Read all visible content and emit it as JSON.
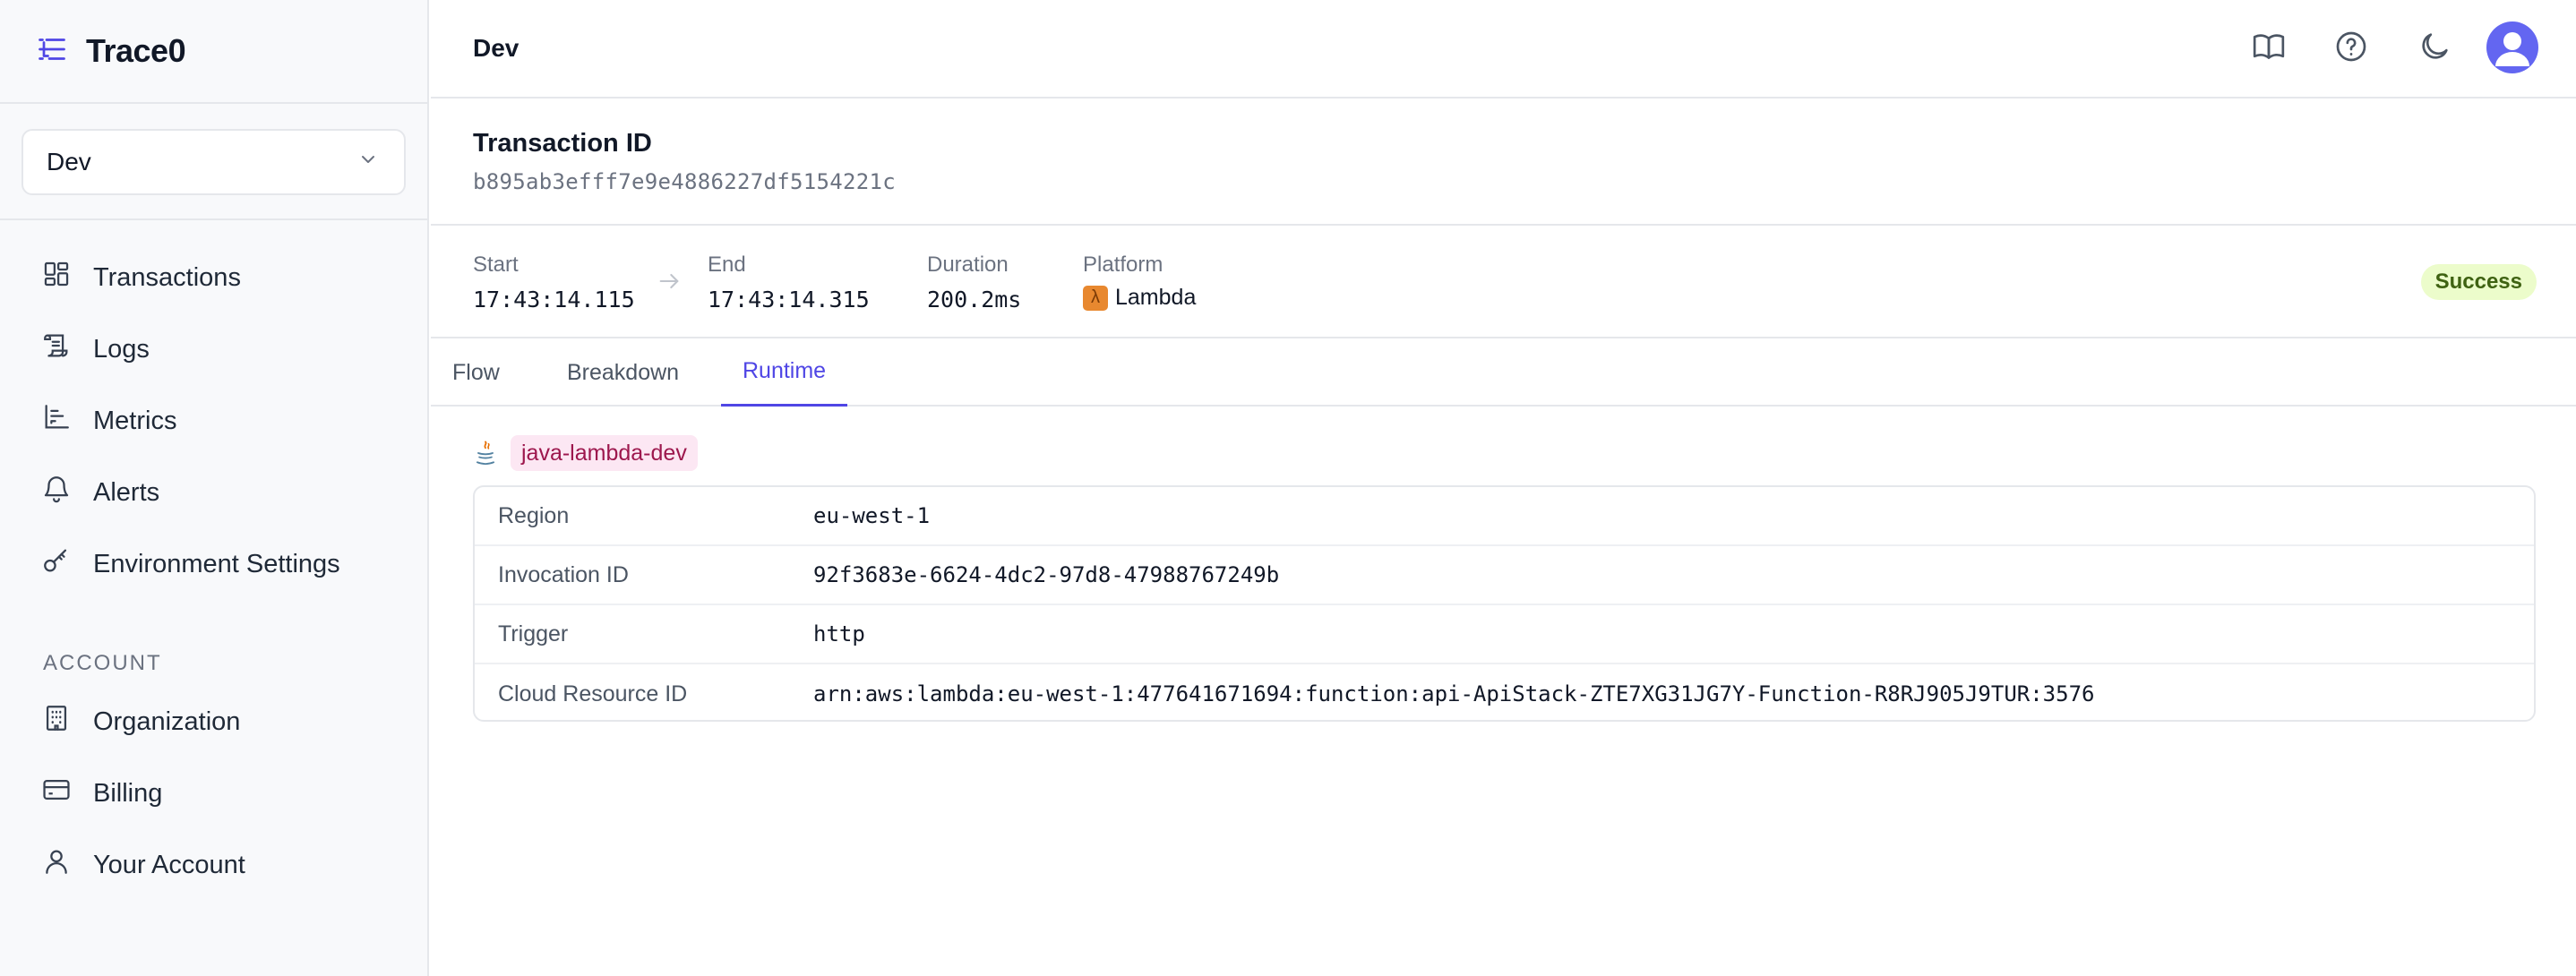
{
  "app": {
    "name": "Trace0",
    "accent": "#4f46e5"
  },
  "sidebar": {
    "environment": "Dev",
    "items": [
      {
        "label": "Transactions",
        "icon": "dashboard-grid-icon"
      },
      {
        "label": "Logs",
        "icon": "scroll-icon"
      },
      {
        "label": "Metrics",
        "icon": "bar-chart-icon"
      },
      {
        "label": "Alerts",
        "icon": "bell-icon"
      },
      {
        "label": "Environment Settings",
        "icon": "key-icon"
      }
    ],
    "account_section": "ACCOUNT",
    "account_items": [
      {
        "label": "Organization",
        "icon": "building-icon"
      },
      {
        "label": "Billing",
        "icon": "credit-card-icon"
      },
      {
        "label": "Your Account",
        "icon": "user-icon"
      }
    ]
  },
  "header": {
    "title": "Dev",
    "icons": [
      "book-icon",
      "help-circle-icon",
      "moon-icon",
      "avatar"
    ]
  },
  "transaction": {
    "label": "Transaction ID",
    "id": "b895ab3efff7e9e4886227df5154221c"
  },
  "meta": {
    "start_label": "Start",
    "start_value": "17:43:14.115",
    "end_label": "End",
    "end_value": "17:43:14.315",
    "duration_label": "Duration",
    "duration_value": "200.2ms",
    "platform_label": "Platform",
    "platform_value": "Lambda",
    "status": "Success"
  },
  "tabs": [
    {
      "label": "Flow",
      "active": false
    },
    {
      "label": "Breakdown",
      "active": false
    },
    {
      "label": "Runtime",
      "active": true
    }
  ],
  "runtime": {
    "service": "java-lambda-dev",
    "rows": [
      {
        "key": "Region",
        "value": "eu-west-1"
      },
      {
        "key": "Invocation ID",
        "value": "92f3683e-6624-4dc2-97d8-47988767249b"
      },
      {
        "key": "Trigger",
        "value": "http"
      },
      {
        "key": "Cloud Resource ID",
        "value": "arn:aws:lambda:eu-west-1:477641671694:function:api-ApiStack-ZTE7XG31JG7Y-Function-R8RJ905J9TUR:3576"
      }
    ]
  }
}
